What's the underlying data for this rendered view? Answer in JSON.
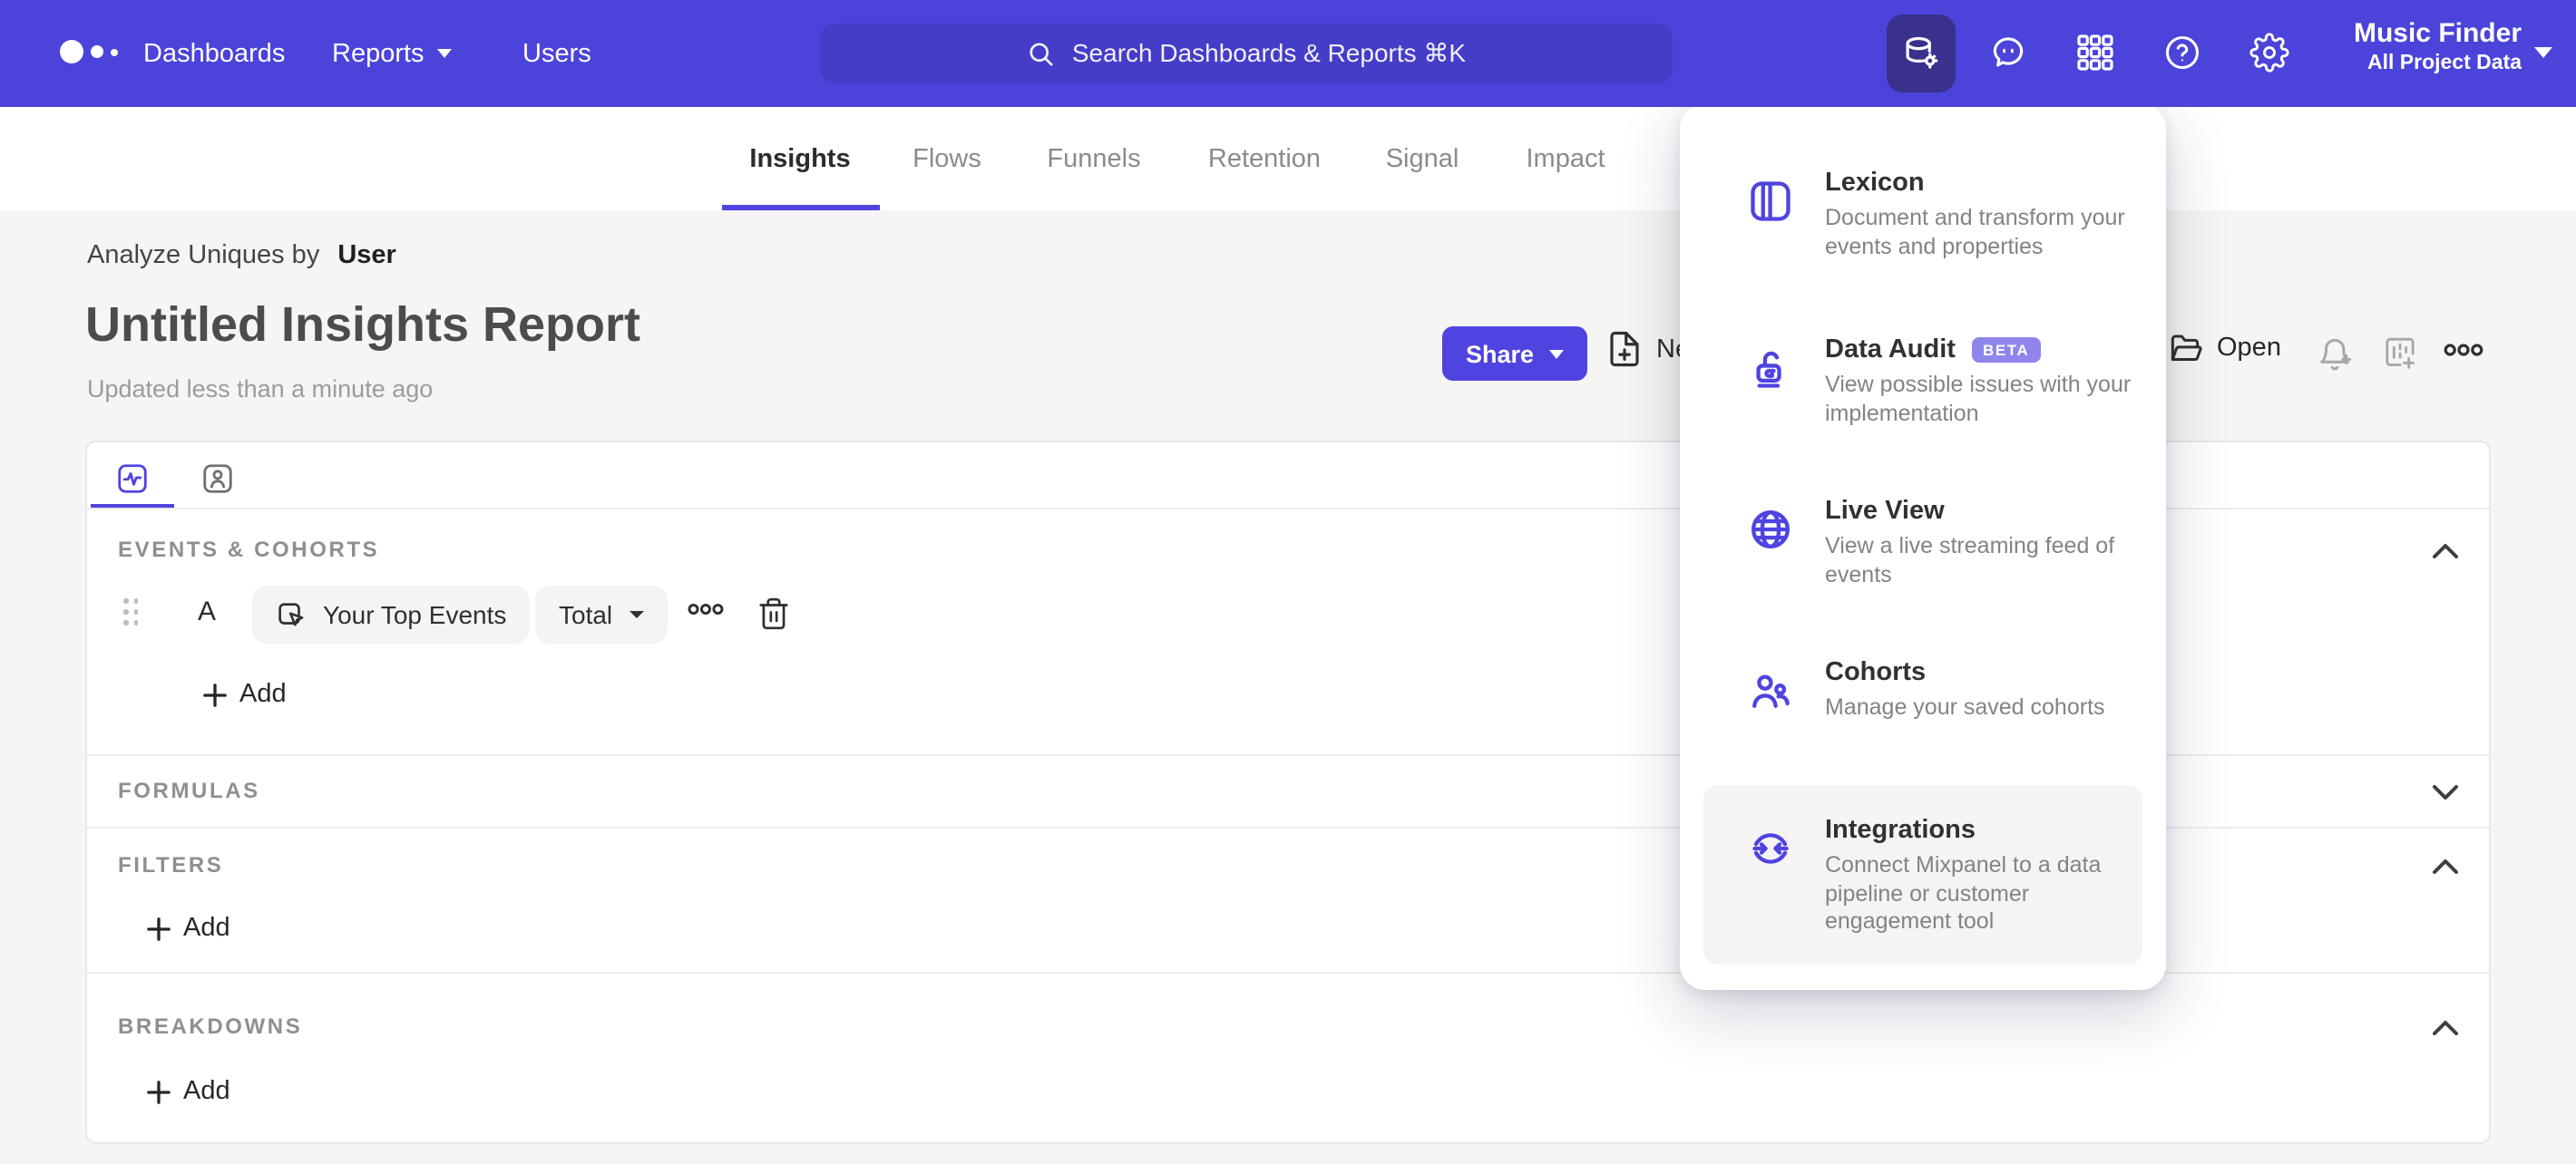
{
  "nav": {
    "brand": "Mixpanel",
    "items": {
      "dashboards": "Dashboards",
      "reports": "Reports",
      "users": "Users"
    },
    "search_placeholder": "Search Dashboards & Reports ⌘K",
    "project_name": "Music Finder",
    "project_scope": "All Project Data"
  },
  "tabs": [
    {
      "label": "Insights"
    },
    {
      "label": "Flows"
    },
    {
      "label": "Funnels"
    },
    {
      "label": "Retention"
    },
    {
      "label": "Signal"
    },
    {
      "label": "Impact"
    }
  ],
  "report": {
    "analyze_label": "Analyze Uniques by",
    "analyze_value": "User",
    "title": "Untitled Insights Report",
    "updated": "Updated less than a minute ago"
  },
  "toolbar": {
    "share_label": "Share",
    "new_label": "New",
    "open_label": "Open"
  },
  "menu": {
    "items": [
      {
        "title": "Lexicon",
        "desc": "Document and transform your events and properties"
      },
      {
        "title": "Data Audit",
        "badge": "BETA",
        "desc": "View possible issues with your implementation"
      },
      {
        "title": "Live View",
        "desc": "View a live streaming feed of events"
      },
      {
        "title": "Cohorts",
        "desc": "Manage your saved cohorts"
      },
      {
        "title": "Integrations",
        "desc": "Connect Mixpanel to a data pipeline or customer engagement tool"
      }
    ]
  },
  "builder": {
    "events_header": "EVENTS & COHORTS",
    "formulas_header": "FORMULAS",
    "filters_header": "FILTERS",
    "breakdowns_header": "BREAKDOWNS",
    "row_letter": "A",
    "row_event": "Your Top Events",
    "row_metric": "Total",
    "add_label": "Add"
  },
  "colors": {
    "accent": "#4f44e0",
    "nav_bg": "#4b43da",
    "nav_search_bg": "#453dc7",
    "nav_active_button_bg": "#39318c",
    "beta_badge_bg": "#8f85eb",
    "page_bg": "#f6f5f3"
  }
}
